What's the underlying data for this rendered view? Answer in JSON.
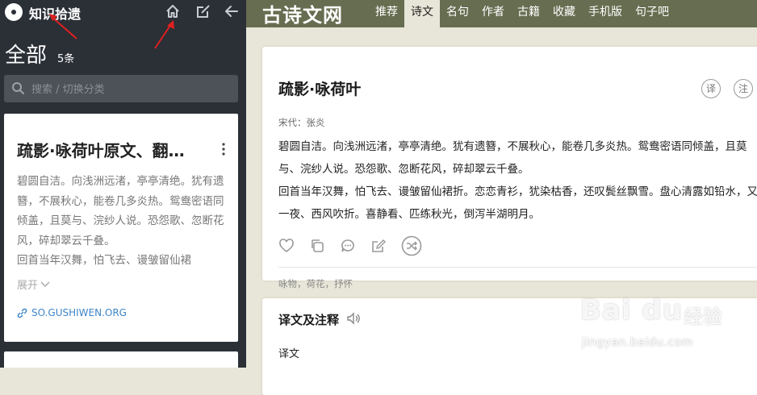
{
  "sidebar": {
    "app_title": "知识拾遗",
    "heading": "全部",
    "count": "5条",
    "search_placeholder": "搜索 / 切换分类",
    "card": {
      "title": "疏影·咏荷叶原文、翻…",
      "lines": [
        "碧圆自洁。向浅洲远渚，亭亭清绝。犹有遗簪，不展秋心，能卷几多炎热。鸳鸯密语同倾盖，且莫与、浣纱人说。恐怨歌、忽断花风，碎却翠云千叠。",
        "回首当年汉舞，怕飞去、谩皱留仙裙"
      ],
      "more_label": "展开",
      "link": "SO.GUSHIWEN.ORG"
    }
  },
  "site": {
    "logo": "古诗文网",
    "nav": [
      "推荐",
      "诗文",
      "名句",
      "作者",
      "古籍",
      "收藏",
      "手机版",
      "句子吧"
    ],
    "active_nav": "诗文"
  },
  "poem": {
    "title": "疏影·咏荷叶",
    "btn_translate": "译",
    "btn_annotate": "注",
    "source": "宋代：张炎",
    "lines": [
      "碧圆自洁。向浅洲远渚，亭亭清绝。犹有遗簪，不展秋心，能卷几多炎热。鸳鸯密语同倾盖，且莫",
      "与、浣纱人说。恐怨歌、忽断花风，碎却翠云千叠。",
      "回首当年汉舞，怕飞去、谩皱留仙裙折。恋恋青衫，犹染枯香，还叹鬓丝飘雪。盘心清露如铅水，又",
      "一夜、西风吹折。喜静看、匹练秋光，倒泻半湖明月。"
    ],
    "tags": "咏物，荷花，抒怀"
  },
  "translation": {
    "title": "译文及注释",
    "subtitle": "译文"
  },
  "watermark": {
    "logo": "Bai du",
    "cn": "经验",
    "url": "jingyan.baidu.com"
  }
}
